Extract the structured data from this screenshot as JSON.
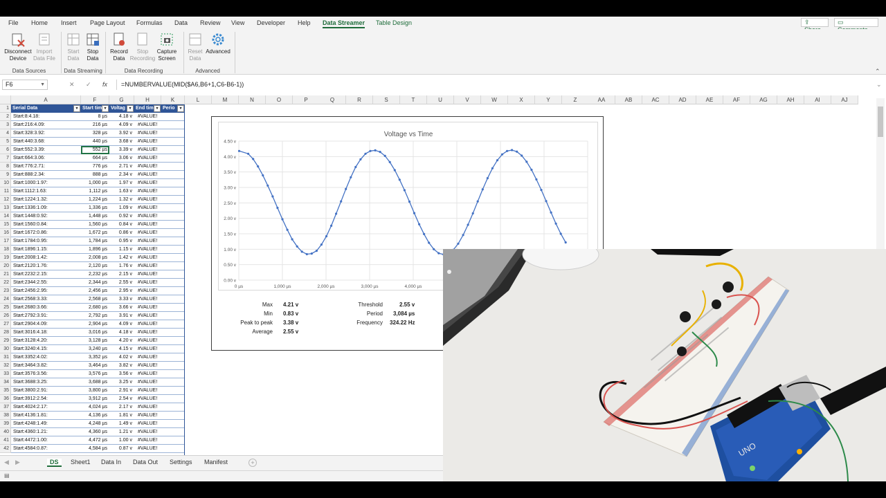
{
  "ribbon_tabs": [
    "File",
    "Home",
    "Insert",
    "Page Layout",
    "Formulas",
    "Data",
    "Review",
    "View",
    "Developer",
    "Help",
    "Data Streamer",
    "Table Design"
  ],
  "share_label": "Share",
  "comments_label": "Comments",
  "ribbon": {
    "buttons": [
      {
        "label": "Disconnect\nDevice",
        "icon": "disconnect-device-icon"
      },
      {
        "label": "Import\nData File",
        "icon": "import-data-file-icon"
      },
      {
        "label": "Start\nData",
        "icon": "start-data-icon"
      },
      {
        "label": "Stop\nData",
        "icon": "stop-data-icon"
      },
      {
        "label": "Record\nData",
        "icon": "record-data-icon"
      },
      {
        "label": "Stop\nRecording",
        "icon": "stop-recording-icon"
      },
      {
        "label": "Capture\nScreen",
        "icon": "capture-screen-icon"
      },
      {
        "label": "Reset\nData",
        "icon": "reset-data-icon"
      },
      {
        "label": "Advanced",
        "icon": "advanced-gear-icon"
      }
    ],
    "groups": [
      "Data Sources",
      "Data Streaming",
      "Data Recording",
      "Advanced"
    ]
  },
  "name_box": "F6",
  "formula": "=NUMBERVALUE(MID($A6,B6+1,C6-B6-1))",
  "fx_symbol": "fx",
  "columns": [
    "A",
    "F",
    "G",
    "H",
    "K",
    "L",
    "M",
    "N",
    "O",
    "P",
    "Q",
    "R",
    "S",
    "T",
    "U",
    "V",
    "W",
    "X",
    "Y",
    "Z",
    "AA",
    "AB",
    "AC",
    "AD",
    "AE",
    "AF",
    "AG",
    "AH",
    "AI",
    "AJ"
  ],
  "table_headers": [
    "Serial Data",
    "Start tim",
    "Voltag",
    "End tim",
    "Perio"
  ],
  "rows": [
    {
      "n": "2",
      "a": "Start:8:4.18:",
      "f": "8 µs",
      "g": "4.18 v",
      "h": "#VALUE!"
    },
    {
      "n": "3",
      "a": "Start:216:4.09:",
      "f": "216 µs",
      "g": "4.09 v",
      "h": "#VALUE!"
    },
    {
      "n": "4",
      "a": "Start:328:3.92:",
      "f": "328 µs",
      "g": "3.92 v",
      "h": "#VALUE!"
    },
    {
      "n": "5",
      "a": "Start:440:3.68:",
      "f": "440 µs",
      "g": "3.68 v",
      "h": "#VALUE!"
    },
    {
      "n": "6",
      "a": "Start:552:3.39:",
      "f": "552 µs",
      "g": "3.39 v",
      "h": "#VALUE!"
    },
    {
      "n": "7",
      "a": "Start:664:3.06:",
      "f": "664 µs",
      "g": "3.06 v",
      "h": "#VALUE!"
    },
    {
      "n": "8",
      "a": "Start:776:2.71:",
      "f": "776 µs",
      "g": "2.71 v",
      "h": "#VALUE!"
    },
    {
      "n": "9",
      "a": "Start:888:2.34:",
      "f": "888 µs",
      "g": "2.34 v",
      "h": "#VALUE!"
    },
    {
      "n": "10",
      "a": "Start:1000:1.97:",
      "f": "1,000 µs",
      "g": "1.97 v",
      "h": "#VALUE!"
    },
    {
      "n": "11",
      "a": "Start:1112:1.63:",
      "f": "1,112 µs",
      "g": "1.63 v",
      "h": "#VALUE!"
    },
    {
      "n": "12",
      "a": "Start:1224:1.32:",
      "f": "1,224 µs",
      "g": "1.32 v",
      "h": "#VALUE!"
    },
    {
      "n": "13",
      "a": "Start:1336:1.09:",
      "f": "1,336 µs",
      "g": "1.09 v",
      "h": "#VALUE!"
    },
    {
      "n": "14",
      "a": "Start:1448:0.92:",
      "f": "1,448 µs",
      "g": "0.92 v",
      "h": "#VALUE!"
    },
    {
      "n": "15",
      "a": "Start:1560:0.84:",
      "f": "1,560 µs",
      "g": "0.84 v",
      "h": "#VALUE!"
    },
    {
      "n": "16",
      "a": "Start:1672:0.86:",
      "f": "1,672 µs",
      "g": "0.86 v",
      "h": "#VALUE!"
    },
    {
      "n": "17",
      "a": "Start:1784:0.95:",
      "f": "1,784 µs",
      "g": "0.95 v",
      "h": "#VALUE!"
    },
    {
      "n": "18",
      "a": "Start:1896:1.15:",
      "f": "1,896 µs",
      "g": "1.15 v",
      "h": "#VALUE!"
    },
    {
      "n": "19",
      "a": "Start:2008:1.42:",
      "f": "2,008 µs",
      "g": "1.42 v",
      "h": "#VALUE!"
    },
    {
      "n": "20",
      "a": "Start:2120:1.76:",
      "f": "2,120 µs",
      "g": "1.76 v",
      "h": "#VALUE!"
    },
    {
      "n": "21",
      "a": "Start:2232:2.15:",
      "f": "2,232 µs",
      "g": "2.15 v",
      "h": "#VALUE!"
    },
    {
      "n": "22",
      "a": "Start:2344:2.55:",
      "f": "2,344 µs",
      "g": "2.55 v",
      "h": "#VALUE!"
    },
    {
      "n": "23",
      "a": "Start:2456:2.95:",
      "f": "2,456 µs",
      "g": "2.95 v",
      "h": "#VALUE!"
    },
    {
      "n": "24",
      "a": "Start:2568:3.33:",
      "f": "2,568 µs",
      "g": "3.33 v",
      "h": "#VALUE!"
    },
    {
      "n": "25",
      "a": "Start:2680:3.66:",
      "f": "2,680 µs",
      "g": "3.66 v",
      "h": "#VALUE!"
    },
    {
      "n": "26",
      "a": "Start:2792:3.91:",
      "f": "2,792 µs",
      "g": "3.91 v",
      "h": "#VALUE!"
    },
    {
      "n": "27",
      "a": "Start:2904:4.09:",
      "f": "2,904 µs",
      "g": "4.09 v",
      "h": "#VALUE!"
    },
    {
      "n": "28",
      "a": "Start:3016:4.18:",
      "f": "3,016 µs",
      "g": "4.18 v",
      "h": "#VALUE!"
    },
    {
      "n": "29",
      "a": "Start:3128:4.20:",
      "f": "3,128 µs",
      "g": "4.20 v",
      "h": "#VALUE!"
    },
    {
      "n": "30",
      "a": "Start:3240:4.15:",
      "f": "3,240 µs",
      "g": "4.15 v",
      "h": "#VALUE!"
    },
    {
      "n": "31",
      "a": "Start:3352:4.02:",
      "f": "3,352 µs",
      "g": "4.02 v",
      "h": "#VALUE!"
    },
    {
      "n": "32",
      "a": "Start:3464:3.82:",
      "f": "3,464 µs",
      "g": "3.82 v",
      "h": "#VALUE!"
    },
    {
      "n": "33",
      "a": "Start:3576:3.56:",
      "f": "3,576 µs",
      "g": "3.56 v",
      "h": "#VALUE!"
    },
    {
      "n": "34",
      "a": "Start:3688:3.25:",
      "f": "3,688 µs",
      "g": "3.25 v",
      "h": "#VALUE!"
    },
    {
      "n": "35",
      "a": "Start:3800:2.91:",
      "f": "3,800 µs",
      "g": "2.91 v",
      "h": "#VALUE!"
    },
    {
      "n": "36",
      "a": "Start:3912:2.54:",
      "f": "3,912 µs",
      "g": "2.54 v",
      "h": "#VALUE!"
    },
    {
      "n": "37",
      "a": "Start:4024:2.17:",
      "f": "4,024 µs",
      "g": "2.17 v",
      "h": "#VALUE!"
    },
    {
      "n": "38",
      "a": "Start:4136:1.81:",
      "f": "4,136 µs",
      "g": "1.81 v",
      "h": "#VALUE!"
    },
    {
      "n": "39",
      "a": "Start:4248:1.49:",
      "f": "4,248 µs",
      "g": "1.49 v",
      "h": "#VALUE!"
    },
    {
      "n": "40",
      "a": "Start:4360:1.21:",
      "f": "4,360 µs",
      "g": "1.21 v",
      "h": "#VALUE!"
    },
    {
      "n": "41",
      "a": "Start:4472:1.00:",
      "f": "4,472 µs",
      "g": "1.00 v",
      "h": "#VALUE!"
    },
    {
      "n": "42",
      "a": "Start:4584:0.87:",
      "f": "4,584 µs",
      "g": "0.87 v",
      "h": "#VALUE!"
    }
  ],
  "chart_data": {
    "type": "line",
    "title": "Voltage vs Time",
    "x_tick_labels": [
      "0 µs",
      "1,000 µs",
      "2,000 µs",
      "3,000 µs",
      "4,000 µs"
    ],
    "y_tick_labels": [
      "0.00 v",
      "0.50 v",
      "1.00 v",
      "1.50 v",
      "2.00 v",
      "2.50 v",
      "3.00 v",
      "3.50 v",
      "4.00 v",
      "4.50 v"
    ],
    "xlim": [
      0,
      8000
    ],
    "ylim": [
      0,
      4.5
    ],
    "grid": true,
    "series": [
      {
        "color": "#4472c4",
        "x": [
          8,
          216,
          328,
          440,
          552,
          664,
          776,
          888,
          1000,
          1112,
          1224,
          1336,
          1448,
          1560,
          1672,
          1784,
          1896,
          2008,
          2120,
          2232,
          2344,
          2456,
          2568,
          2680,
          2792,
          2904,
          3016,
          3128,
          3240,
          3352,
          3464,
          3576,
          3688,
          3800,
          3912,
          4024,
          4136,
          4248,
          4360,
          4472,
          4584,
          4696,
          4808,
          4920,
          5032,
          5144,
          5256,
          5368,
          5480,
          5592,
          5704,
          5816,
          5928,
          6040,
          6152,
          6264,
          6376,
          6488,
          6600,
          6712,
          6824,
          6936,
          7048,
          7160,
          7272,
          7384,
          7496
        ],
        "y": [
          4.18,
          4.09,
          3.92,
          3.68,
          3.39,
          3.06,
          2.71,
          2.34,
          1.97,
          1.63,
          1.32,
          1.09,
          0.92,
          0.84,
          0.86,
          0.95,
          1.15,
          1.42,
          1.76,
          2.15,
          2.55,
          2.95,
          3.33,
          3.66,
          3.91,
          4.09,
          4.18,
          4.2,
          4.15,
          4.02,
          3.82,
          3.56,
          3.25,
          2.91,
          2.54,
          2.17,
          1.81,
          1.49,
          1.21,
          1.0,
          0.87,
          0.83,
          0.86,
          0.98,
          1.18,
          1.46,
          1.79,
          2.16,
          2.55,
          2.94,
          3.3,
          3.62,
          3.88,
          4.07,
          4.18,
          4.21,
          4.16,
          4.03,
          3.83,
          3.57,
          3.26,
          2.92,
          2.56,
          2.19,
          1.83,
          1.5,
          1.22
        ]
      }
    ]
  },
  "stats": {
    "max_label": "Max",
    "max_value": "4.21 v",
    "min_label": "Min",
    "min_value": "0.83 v",
    "ptp_label": "Peak to peak",
    "ptp_value": "3.38 v",
    "avg_label": "Average",
    "avg_value": "2.55 v",
    "threshold_label": "Threshold",
    "threshold_value": "2.55 v",
    "period_label": "Period",
    "period_value": "3,084 µs",
    "freq_label": "Frequency",
    "freq_value": "324.22 Hz"
  },
  "sheet_tabs": [
    "DS",
    "Sheet1",
    "Data In",
    "Data Out",
    "Settings",
    "Manifest"
  ],
  "add_sheet_symbol": "+"
}
